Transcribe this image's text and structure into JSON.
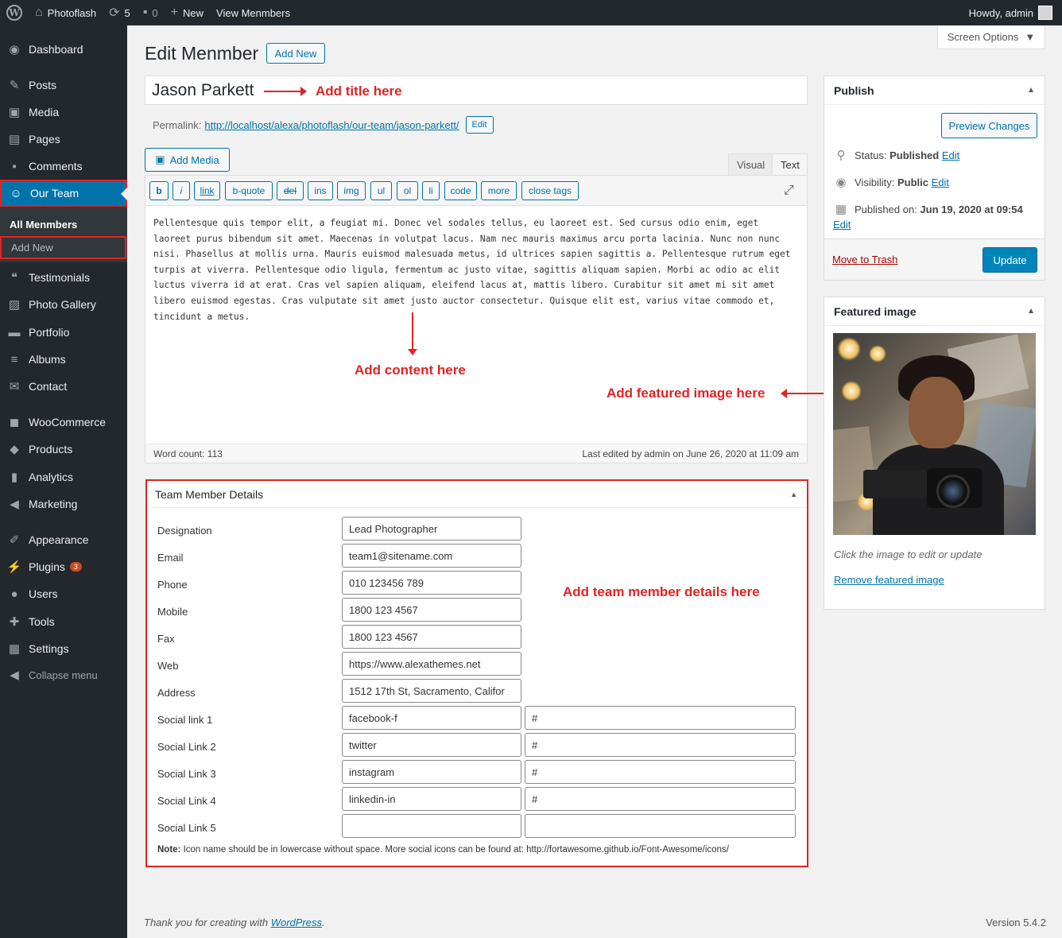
{
  "adminbar": {
    "site_name": "Photoflash",
    "updates_count": "5",
    "comments_count": "0",
    "new_label": "New",
    "view_label": "View Menmbers",
    "howdy": "Howdy, admin"
  },
  "sidebar": {
    "items": [
      {
        "label": "Dashboard",
        "icon": "dashboard-icon"
      },
      {
        "label": "Posts",
        "icon": "pin-icon"
      },
      {
        "label": "Media",
        "icon": "media-icon"
      },
      {
        "label": "Pages",
        "icon": "pages-icon"
      },
      {
        "label": "Comments",
        "icon": "comments-icon"
      },
      {
        "label": "Our Team",
        "icon": "team-icon"
      },
      {
        "label": "Testimonials",
        "icon": "quote-icon"
      },
      {
        "label": "Photo Gallery",
        "icon": "gallery-icon"
      },
      {
        "label": "Portfolio",
        "icon": "portfolio-icon"
      },
      {
        "label": "Albums",
        "icon": "albums-icon"
      },
      {
        "label": "Contact",
        "icon": "mail-icon"
      },
      {
        "label": "WooCommerce",
        "icon": "woo-icon"
      },
      {
        "label": "Products",
        "icon": "products-icon"
      },
      {
        "label": "Analytics",
        "icon": "analytics-icon"
      },
      {
        "label": "Marketing",
        "icon": "megaphone-icon"
      },
      {
        "label": "Appearance",
        "icon": "brush-icon"
      },
      {
        "label": "Plugins",
        "icon": "plugin-icon",
        "badge": "3"
      },
      {
        "label": "Users",
        "icon": "user-icon"
      },
      {
        "label": "Tools",
        "icon": "wrench-icon"
      },
      {
        "label": "Settings",
        "icon": "settings-icon"
      }
    ],
    "submenu": {
      "all": "All Menmbers",
      "add_new": "Add New"
    },
    "collapse": "Collapse menu"
  },
  "header": {
    "title": "Edit Menmber",
    "add_new": "Add New",
    "screen_options": "Screen Options"
  },
  "post": {
    "title": "Jason Parkett",
    "permalink_label": "Permalink:",
    "permalink_url": "http://localhost/alexa/photoflash/our-team/jason-parkett/",
    "permalink_edit": "Edit"
  },
  "editor": {
    "add_media": "Add Media",
    "tab_visual": "Visual",
    "tab_text": "Text",
    "buttons": [
      "b",
      "i",
      "link",
      "b-quote",
      "del",
      "ins",
      "img",
      "ul",
      "ol",
      "li",
      "code",
      "more",
      "close tags"
    ],
    "content": "Pellentesque quis tempor elit, a feugiat mi. Donec vel sodales tellus, eu laoreet est. Sed cursus odio enim, eget laoreet purus bibendum sit amet. Maecenas in volutpat lacus. Nam nec mauris maximus arcu porta lacinia. Nunc non nunc nisi. Phasellus at mollis urna. Mauris euismod malesuada metus, id ultrices sapien sagittis a. Pellentesque rutrum eget turpis at viverra. Pellentesque odio ligula, fermentum ac justo vitae, sagittis aliquam sapien. Morbi ac odio ac elit luctus viverra id at erat. Cras vel sapien aliquam, eleifend lacus at, mattis libero. Curabitur sit amet mi sit amet libero euismod egestas. Cras vulputate sit amet justo auctor consectetur. Quisque elit est, varius vitae commodo et, tincidunt a metus.",
    "word_count": "Word count: 113",
    "last_edited": "Last edited by admin on June 26, 2020 at 11:09 am"
  },
  "annotations": {
    "title": "Add title here",
    "content": "Add content here",
    "featured": "Add featured image here",
    "details": "Add team member details here"
  },
  "team": {
    "heading": "Team Member Details",
    "fields": [
      {
        "label": "Designation",
        "value": "Lead Photographer"
      },
      {
        "label": "Email",
        "value": "team1@sitename.com"
      },
      {
        "label": "Phone",
        "value": "010 123456 789"
      },
      {
        "label": "Mobile",
        "value": "1800 123 4567"
      },
      {
        "label": "Fax",
        "value": "1800 123 4567"
      },
      {
        "label": "Web",
        "value": "https://www.alexathemes.net"
      },
      {
        "label": "Address",
        "value": "1512 17th St, Sacramento, Califor"
      }
    ],
    "social": [
      {
        "label": "Social link 1",
        "icon": "facebook-f",
        "url": "#"
      },
      {
        "label": "Social Link 2",
        "icon": "twitter",
        "url": "#"
      },
      {
        "label": "Social Link 3",
        "icon": "instagram",
        "url": "#"
      },
      {
        "label": "Social Link 4",
        "icon": "linkedin-in",
        "url": "#"
      },
      {
        "label": "Social Link 5",
        "icon": "",
        "url": ""
      }
    ],
    "note_bold": "Note:",
    "note_text": " Icon name should be in lowercase without space. More social icons can be found at: http://fortawesome.github.io/Font-Awesome/icons/"
  },
  "publish": {
    "heading": "Publish",
    "preview": "Preview Changes",
    "status_label": "Status:",
    "status_value": "Published",
    "visibility_label": "Visibility:",
    "visibility_value": "Public",
    "published_label": "Published on:",
    "published_value": "Jun 19, 2020 at 09:54",
    "edit": "Edit",
    "trash": "Move to Trash",
    "update": "Update"
  },
  "featured": {
    "heading": "Featured image",
    "caption": "Click the image to edit or update",
    "remove": "Remove featured image"
  },
  "footer": {
    "thanks_prefix": "Thank you for creating with ",
    "wordpress": "WordPress",
    "thanks_suffix": ".",
    "version": "Version 5.4.2"
  },
  "colors": {
    "accent": "#0073aa",
    "annotation": "#e02424",
    "sidebar_bg": "#23282d",
    "primary_button": "#0085ba"
  }
}
